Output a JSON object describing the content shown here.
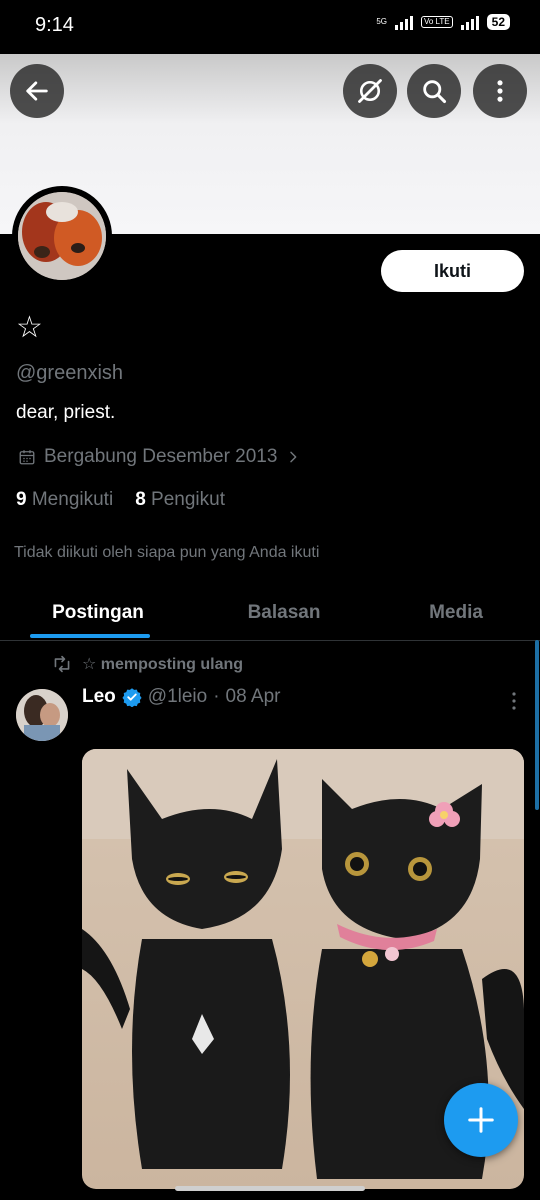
{
  "status": {
    "time": "9:14",
    "network1": "5G",
    "volte": "Vo LTE",
    "battery": "52"
  },
  "profile": {
    "display_name": "☆",
    "handle": "@greenxish",
    "bio": "dear, priest.",
    "joined": "Bergabung Desember 2013",
    "following_count": "9",
    "following_label": "Mengikuti",
    "followers_count": "8",
    "followers_label": "Pengikut",
    "followed_by": "Tidak diikuti oleh siapa pun yang Anda ikuti",
    "follow_button": "Ikuti"
  },
  "tabs": [
    {
      "label": "Postingan",
      "active": true
    },
    {
      "label": "Balasan",
      "active": false
    },
    {
      "label": "Media",
      "active": false
    }
  ],
  "post": {
    "repost_label": "☆ memposting ulang",
    "author_name": "Leo",
    "verified": true,
    "author_handle": "@1leio",
    "separator": "·",
    "date": "08 Apr"
  },
  "icons": {
    "back": "arrow-left-icon",
    "grok": "grok-icon",
    "search": "search-icon",
    "more": "more-vertical-icon",
    "calendar": "calendar-icon",
    "repost": "repost-icon",
    "verified": "verified-badge-icon",
    "compose": "plus-icon"
  },
  "colors": {
    "accent": "#1d9bf0",
    "background": "#000000",
    "muted": "#71767b"
  }
}
